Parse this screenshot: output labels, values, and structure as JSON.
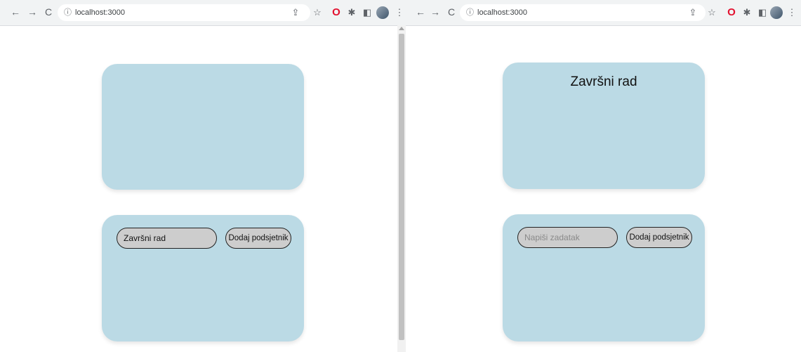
{
  "left_window": {
    "nav": {
      "back": "←",
      "forward": "→",
      "reload": "C"
    },
    "address_bar": {
      "info_icon": "ⓘ",
      "url": "localhost:3000"
    },
    "toolbar": {
      "share": "⇪",
      "bookmark": "☆",
      "opera": "O",
      "extensions": "✱",
      "sidepanel": "◧",
      "profile": "●",
      "menu": "⋮"
    },
    "app": {
      "title": "",
      "form": {
        "input_value": "Završni rad",
        "input_placeholder": "Napiši zadatak",
        "button_label": "Dodaj podsjetnik"
      }
    }
  },
  "right_window": {
    "nav": {
      "back": "←",
      "forward": "→",
      "reload": "C"
    },
    "address_bar": {
      "info_icon": "ⓘ",
      "url": "localhost:3000"
    },
    "toolbar": {
      "share": "⇪",
      "bookmark": "☆",
      "opera": "O",
      "extensions": "✱",
      "sidepanel": "◧",
      "profile": "●",
      "menu": "⋮"
    },
    "app": {
      "title": "Završni rad",
      "form": {
        "input_value": "",
        "input_placeholder": "Napiši zadatak",
        "button_label": "Dodaj podsjetnik"
      }
    }
  },
  "colors": {
    "card_bg": "#bbdae5",
    "control_bg": "#cdcdcd",
    "control_border": "#222222",
    "toolbar_bg": "#f1f3f4"
  }
}
